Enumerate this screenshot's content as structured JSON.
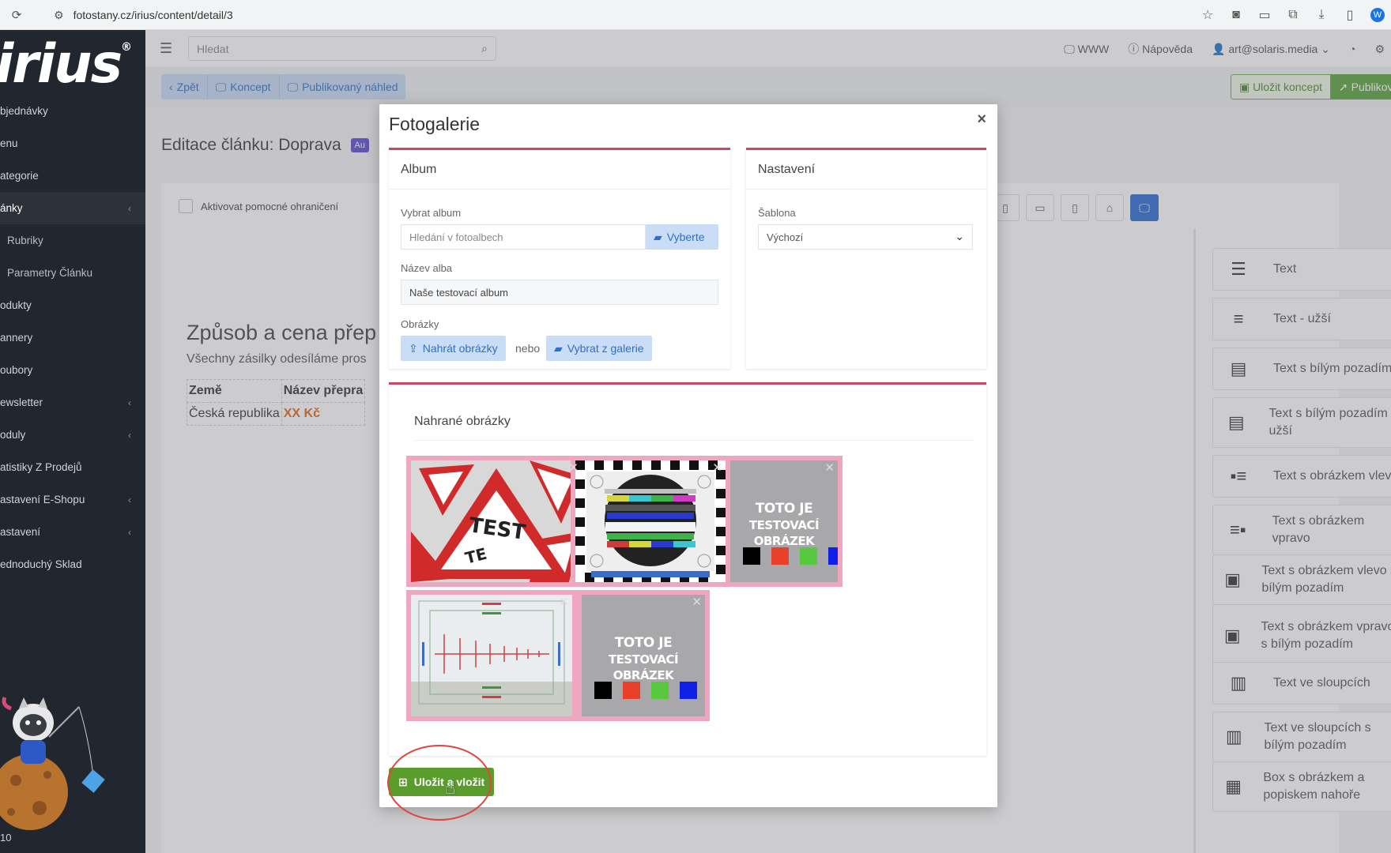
{
  "browser": {
    "url": "fotostany.cz/irius/content/detail/3"
  },
  "sidebar": {
    "logo": "irius",
    "logo_mark": "®",
    "items": [
      {
        "label": "bjednávky",
        "chevron": ""
      },
      {
        "label": "enu",
        "chevron": ""
      },
      {
        "label": "ategorie",
        "chevron": ""
      },
      {
        "label": "ánky",
        "chevron": "‹"
      },
      {
        "label": "Rubriky",
        "chevron": ""
      },
      {
        "label": "Parametry Článku",
        "chevron": ""
      },
      {
        "label": "odukty",
        "chevron": ""
      },
      {
        "label": "annery",
        "chevron": ""
      },
      {
        "label": "oubory",
        "chevron": ""
      },
      {
        "label": "ewsletter",
        "chevron": "‹"
      },
      {
        "label": "oduly",
        "chevron": "‹"
      },
      {
        "label": "atistiky Z Prodejů",
        "chevron": ""
      },
      {
        "label": "astavení E-Shopu",
        "chevron": "‹"
      },
      {
        "label": "astavení",
        "chevron": "‹"
      },
      {
        "label": "ednoduchý Sklad",
        "chevron": ""
      }
    ],
    "footer": "10"
  },
  "topbar": {
    "search_placeholder": "Hledat",
    "www": "WWW",
    "help": "Nápověda",
    "user": "art@solaris.media"
  },
  "actionbar": {
    "back": "Zpět",
    "concept": "Koncept",
    "published_preview": "Publikovaný náhled",
    "save_concept": "Uložit koncept",
    "publish": "Publikova"
  },
  "editor": {
    "title": "Editace článku:",
    "title_name": "Doprava",
    "badge": "Au",
    "helper_checkbox": "Aktivovat pomocné ohraničení",
    "article_heading": "Způsob a cena přep",
    "article_text": "Všechny zásilky odesíláme pros",
    "table": {
      "headers": [
        "Země",
        "Název přepra"
      ],
      "row": [
        "Česká republika",
        "XX Kč"
      ]
    }
  },
  "blocks": [
    {
      "label": "Text",
      "icon": "align-justify-icon"
    },
    {
      "label": "Text - užší",
      "icon": "align-center-icon"
    },
    {
      "label": "Text s bílým pozadím",
      "icon": "text-box-icon"
    },
    {
      "label": "Text s bílým pozadím - užší",
      "icon": "text-box-narrow-icon"
    },
    {
      "label": "Text s obrázkem vlevo",
      "icon": "image-left-icon"
    },
    {
      "label": "Text s obrázkem vpravo",
      "icon": "image-right-icon"
    },
    {
      "label": "Text s obrázkem vlevo s bílým pozadím",
      "icon": "image-left-box-icon"
    },
    {
      "label": "Text s obrázkem vpravo s bílým pozadím",
      "icon": "image-right-box-icon"
    },
    {
      "label": "Text ve sloupcích",
      "icon": "columns-icon"
    },
    {
      "label": "Text ve sloupcích s bílým pozadím",
      "icon": "columns-box-icon"
    },
    {
      "label": "Box s obrázkem a popiskem nahoře",
      "icon": "image-caption-icon"
    }
  ],
  "modal": {
    "title": "Fotogalerie",
    "close": "×",
    "album_panel": {
      "title": "Album",
      "select_album_label": "Vybrat album",
      "search_placeholder": "Hledání v fotoalbech",
      "select_button": "Vyberte",
      "album_name_label": "Název alba",
      "album_name_value": "Naše testovací album",
      "images_label": "Obrázky",
      "upload_button": "Nahrát obrázky",
      "or": "nebo",
      "gallery_button": "Vybrat z galerie"
    },
    "settings_panel": {
      "title": "Nastavení",
      "template_label": "Šablona",
      "template_value": "Výchozí"
    },
    "uploaded": {
      "title": "Nahrané obrázky",
      "images": [
        {
          "type": "test-signs",
          "text": "TEST"
        },
        {
          "type": "test-pattern",
          "text": ""
        },
        {
          "type": "test-card",
          "text": "TOTO JE TESTOVACÍ OBRÁZEK"
        },
        {
          "type": "resolution-chart",
          "text": ""
        },
        {
          "type": "test-card",
          "text": "TOTO JE TESTOVACÍ OBRÁZEK"
        }
      ],
      "testcard_line1": "TOTO JE",
      "testcard_line2": "TESTOVACÍ OBRÁZEK",
      "swatch_colors": [
        "#000000",
        "#e8402a",
        "#58c93f",
        "#1020e8"
      ]
    },
    "save_insert_button": "Uložit a vložit"
  },
  "colors": {
    "accent_blue": "#2f6fc4",
    "panel_border": "#c84866",
    "save_green": "#5a9d2c",
    "thumb_border": "#f0a6c0",
    "sidebar_bg": "#22262e"
  }
}
